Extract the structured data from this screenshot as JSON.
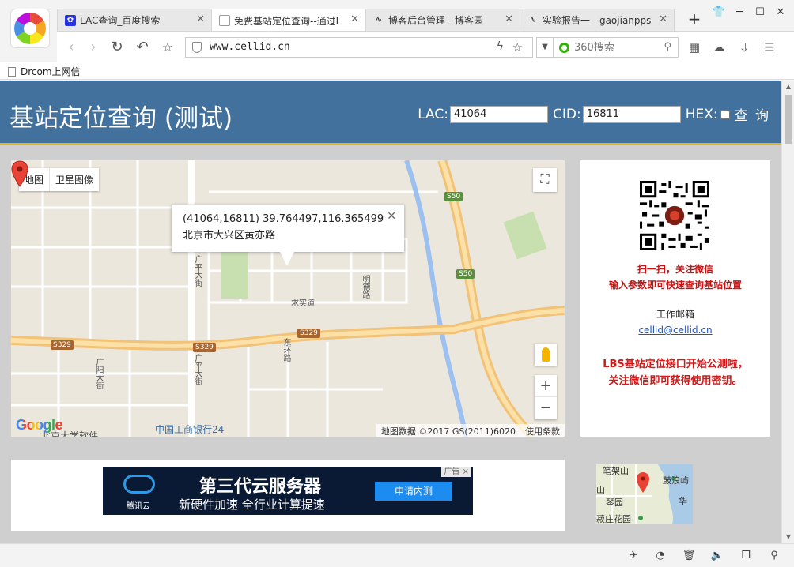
{
  "browser": {
    "tabs": [
      {
        "title": "LAC查询_百度搜索",
        "icon": "baidu-paw-icon",
        "active": false
      },
      {
        "title": "免费基站定位查询--通过L",
        "icon": "page-icon",
        "active": true
      },
      {
        "title": "博客后台管理 - 博客园",
        "icon": "cnblogs-icon",
        "active": false
      },
      {
        "title": "实验报告一 - gaojianpps",
        "icon": "cnblogs-icon",
        "active": false
      }
    ],
    "new_tab": "+",
    "url": "www.cellid.cn",
    "search_placeholder": "360搜索",
    "bookmark": "Drcom上网信"
  },
  "site": {
    "title": "基站定位查询 (测试)",
    "lac_label": "LAC:",
    "lac_value": "41064",
    "cid_label": "CID:",
    "cid_value": "16811",
    "hex_label": "HEX:",
    "query_button": "查 询"
  },
  "map": {
    "type_map": "地图",
    "type_satellite": "卫星图像",
    "info_line1": "(41064,16811) 39.764497,116.365499",
    "info_line2": "北京市大兴区黄亦路",
    "google": "Google",
    "attribution": "地图数据 ©2017 GS(2011)6020",
    "terms": "使用条款",
    "labels": {
      "s50a": "S50",
      "s50b": "S50",
      "s329a": "S329",
      "s329b": "S329",
      "s329c": "S329",
      "guangping": "广平大街",
      "guangping2": "广平大街",
      "guangyang": "广阳大街",
      "dongliu": "东环路",
      "qiushi": "求实道",
      "mingde": "明德路",
      "bank": "中国工商银行24",
      "university": "北京大学软件"
    }
  },
  "side": {
    "scan_line1": "扫一扫，关注微信",
    "scan_line2": "输入参数即可快速查询基站位置",
    "email_title": "工作邮箱",
    "email": "cellid@cellid.cn",
    "lbs_line1": "LBS基站定位接口开始公测啦，",
    "lbs_line2": "关注微信即可获得使用密钥。"
  },
  "ad": {
    "brand": "腾讯云",
    "title": "第三代云服务器",
    "subtitle": "新硬件加速 全行业计算提速",
    "button": "申请内测",
    "tag": "广告 ×"
  },
  "mini_map": {
    "labels": [
      "笔架山",
      "鼓浪屿",
      "山",
      "华",
      "琴园",
      "菽庄花园"
    ]
  }
}
